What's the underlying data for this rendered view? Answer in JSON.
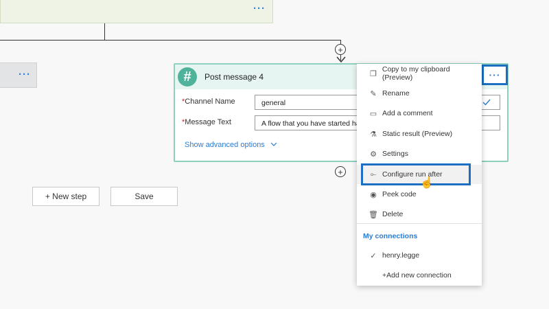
{
  "top_card": {
    "more_label": "···"
  },
  "left_card": {
    "more_label": "···"
  },
  "card": {
    "title": "Post message 4",
    "more_label": "···",
    "fields": [
      {
        "label": "Channel Name",
        "value": "general"
      },
      {
        "label": "Message Text",
        "value": "A flow that you have started has"
      }
    ],
    "advanced_link": "Show advanced options"
  },
  "buttons": {
    "new_step": "+ New step",
    "save": "Save"
  },
  "menu": {
    "items": [
      {
        "label": "Copy to my clipboard (Preview)",
        "icon": "copy-icon"
      },
      {
        "label": "Rename",
        "icon": "pencil-icon"
      },
      {
        "label": "Add a comment",
        "icon": "comment-icon"
      },
      {
        "label": "Static result (Preview)",
        "icon": "flask-icon"
      },
      {
        "label": "Settings",
        "icon": "gear-icon"
      },
      {
        "label": "Configure run after",
        "icon": "run-after-icon"
      },
      {
        "label": "Peek code",
        "icon": "eye-icon"
      },
      {
        "label": "Delete",
        "icon": "trash-icon"
      }
    ],
    "connections_heading": "My connections",
    "connections": [
      {
        "label": "henry.legge",
        "selected": true
      }
    ],
    "add_connection": "+Add new connection"
  },
  "colors": {
    "accent": "#2b7cd3",
    "highlight_border": "#1b6ec2",
    "slack_green": "#4fb39c"
  }
}
